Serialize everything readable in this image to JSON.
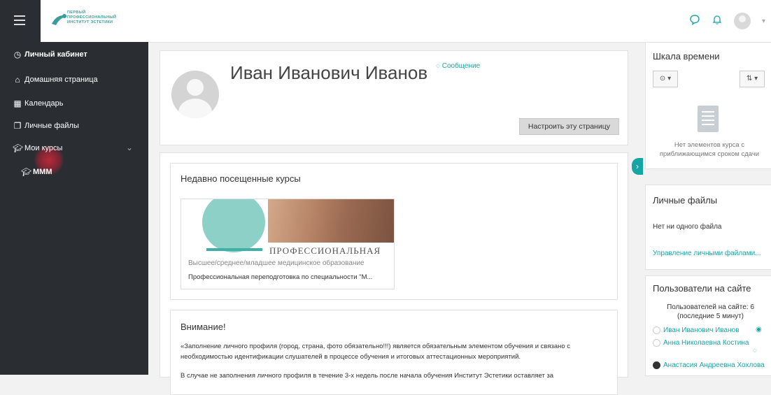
{
  "header": {
    "logo_lines": [
      "ПЕРВЫЙ",
      "ПРОФЕССИОНАЛЬНЫЙ",
      "ИНСТИТУТ ЭСТЕТИКИ"
    ],
    "icons": [
      "chat-icon",
      "bell-icon",
      "user-avatar"
    ]
  },
  "sidebar": {
    "items": [
      {
        "label": "Личный кабинет",
        "icon": "dashboard-icon"
      },
      {
        "label": "Домашняя страница",
        "icon": "home-icon"
      },
      {
        "label": "Календарь",
        "icon": "calendar-icon"
      },
      {
        "label": "Личные файлы",
        "icon": "files-icon"
      },
      {
        "label": "Мои курсы",
        "icon": "graduation-cap-icon"
      },
      {
        "label": "МММ",
        "icon": "graduation-cap-icon"
      }
    ]
  },
  "profile": {
    "name": "Иван Иванович Иванов",
    "message_link": "Сообщение",
    "customize_button": "Настроить эту страницу"
  },
  "recent_courses": {
    "title": "Недавно посещенные курсы",
    "course": {
      "image_text": "ПРОФЕССИОНАЛЬНАЯ",
      "category": "Высшее/среднее/младшее медицинское образование",
      "name": "Профессиональная переподготовка по специальности \"М..."
    }
  },
  "attention": {
    "title": "Внимание!",
    "paragraph1": "«Заполнение личного профиля (город, страна, фото обязательно!!!) является обязательным элементом обучения и связано с необходимостью идентификации слушателей в процессе обучения и итоговых аттестационных мероприятий.",
    "paragraph2": "В случае не заполнения личного профиля в течение 3-х недель после начала обучения Институт Эстетики оставляет за"
  },
  "timeline": {
    "title": "Шкала времени",
    "empty_text": "Нет элементов курса с приближающимся сроком сдачи"
  },
  "private_files": {
    "title": "Личные файлы",
    "none_text": "Нет ни одного файла",
    "manage_link": "Управление личными файлами..."
  },
  "online_users": {
    "title": "Пользователи на сайте",
    "count_text": "Пользователей на сайте: 6 (последние 5 минут)",
    "users": [
      "Иван Иванович Иванов",
      "Анна Николаевна Костина",
      "Анастасия Андреевна Хохлова"
    ]
  },
  "colors": {
    "accent": "#16a5a5",
    "sidebar_bg": "#2a2e33",
    "page_bg": "#f2f2f2"
  }
}
